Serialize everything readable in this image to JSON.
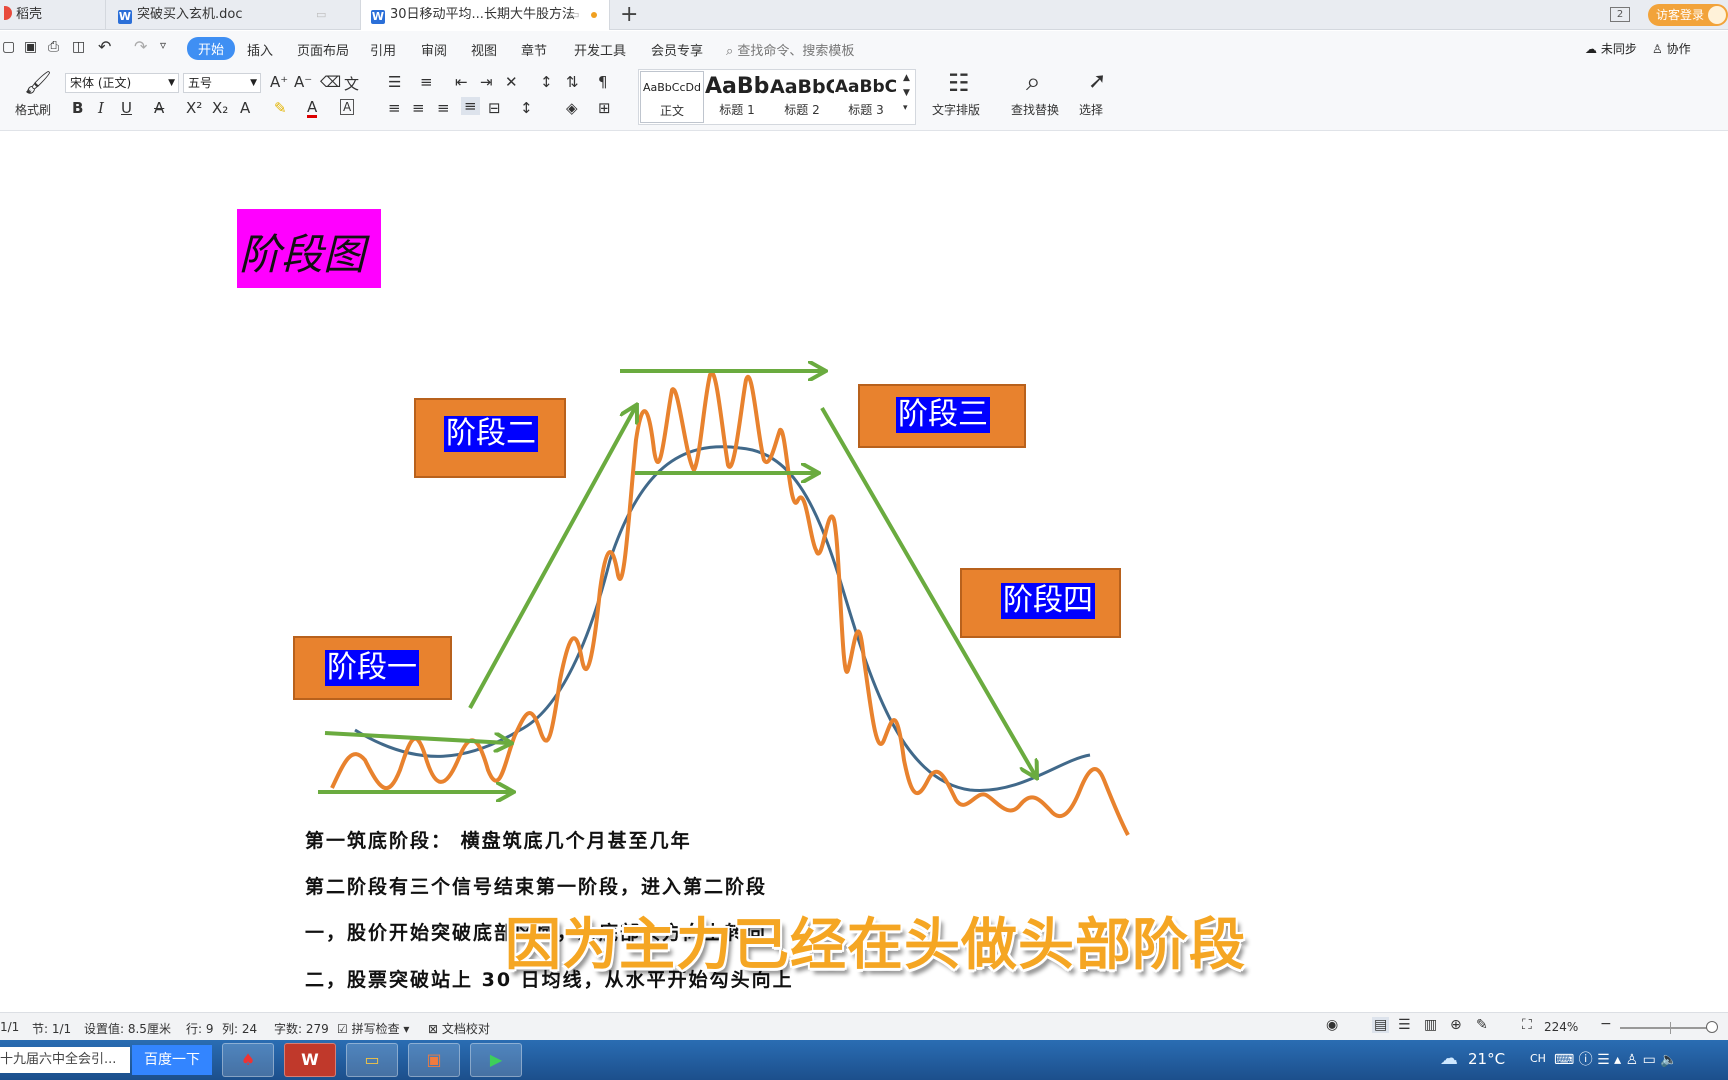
{
  "tabs": [
    {
      "label": "稻壳",
      "active": false
    },
    {
      "label": "突破买入玄机.doc",
      "active": false
    },
    {
      "label": "30日移动平均...长期大牛股方法",
      "active": true
    }
  ],
  "tabbar_right": {
    "page_count": "2",
    "login": "访客登录"
  },
  "menu": {
    "items": [
      "开始",
      "插入",
      "页面布局",
      "引用",
      "审阅",
      "视图",
      "章节",
      "开发工具",
      "会员专享"
    ],
    "search_placeholder": "查找命令、搜索模板",
    "sync": "未同步",
    "collab": "协作"
  },
  "ribbon": {
    "format_painter": "格式刷",
    "font_name": "宋体 (正文)",
    "font_size": "五号",
    "styles": [
      {
        "sample": "AaBbCcDd",
        "label": "正文"
      },
      {
        "sample": "AaBb",
        "label": "标题 1"
      },
      {
        "sample": "AaBbC",
        "label": "标题 2"
      },
      {
        "sample": "AaBbC",
        "label": "标题 3"
      }
    ],
    "text_layout": "文字排版",
    "find_replace": "查找替换",
    "select": "选择"
  },
  "document": {
    "heading": "阶段图",
    "stages": [
      "阶段一",
      "阶段二",
      "阶段三",
      "阶段四"
    ],
    "paragraphs": [
      "第一筑底阶段：  横盘筑底几个月甚至几年",
      "第二阶段有三个信号结束第一阶段，进入第二阶段",
      "一，股价开始突破底部区域，从底部头方向上转向",
      "二，股票突破站上 30 日均线，从水平开始勾头向上"
    ],
    "subtitle": "因为主力已经在头做头部阶段",
    "colors": {
      "price_line": "#e8822e",
      "ma_line": "#41698a",
      "arrows": "#6aab3f",
      "heading_bg": "#ff00ff"
    }
  },
  "statusbar": {
    "page": "1/1",
    "section": "节: 1/1",
    "setting": "设置值: 8.5厘米",
    "row": "行: 9",
    "col": "列: 24",
    "words": "字数: 279",
    "spellcheck": "拼写检查",
    "proofread": "文档校对",
    "zoom": "224%"
  },
  "taskbar": {
    "search_text": "十九届六中全会引...",
    "search_button": "百度一下",
    "weather": "21°C",
    "lang": "CH"
  }
}
